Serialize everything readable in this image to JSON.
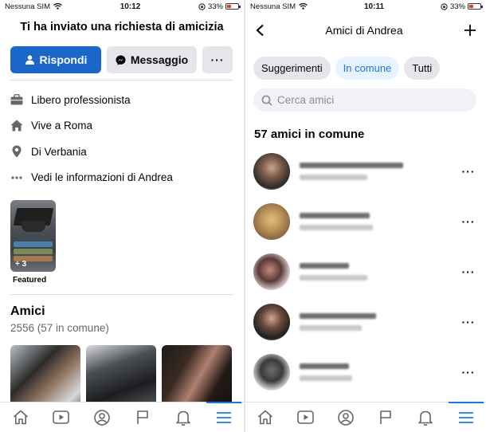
{
  "left": {
    "status": {
      "carrier": "Nessuna SIM",
      "time": "10:12",
      "battery": "33%"
    },
    "request_title": "Ti ha inviato una richiesta di amicizia",
    "actions": {
      "respond": "Rispondi",
      "message": "Messaggio",
      "more": "···"
    },
    "info": [
      {
        "icon": "briefcase-icon",
        "text": "Libero professionista"
      },
      {
        "icon": "home-icon",
        "text": "Vive a Roma"
      },
      {
        "icon": "location-pin-icon",
        "text": "Di Verbania"
      },
      {
        "icon": "more-horizontal-icon",
        "text": "Vedi le informazioni di Andrea"
      }
    ],
    "featured": {
      "count": "+ 3",
      "label": "Featured"
    },
    "friends": {
      "title": "Amici",
      "subtitle": "2556 (57 in comune)"
    }
  },
  "right": {
    "status": {
      "carrier": "Nessuna SIM",
      "time": "10:11",
      "battery": "33%"
    },
    "nav_title": "Amici di Andrea",
    "chips": [
      "Suggerimenti",
      "In comune",
      "Tutti"
    ],
    "active_chip": "In comune",
    "search_placeholder": "Cerca amici",
    "common_count_label": "57 amici in comune",
    "row_more": "···"
  },
  "colors": {
    "accent": "#1877f2",
    "primary_button": "#1b66c9",
    "chip_bg": "#e4e6eb",
    "active_chip_bg": "#e7f3ff"
  }
}
